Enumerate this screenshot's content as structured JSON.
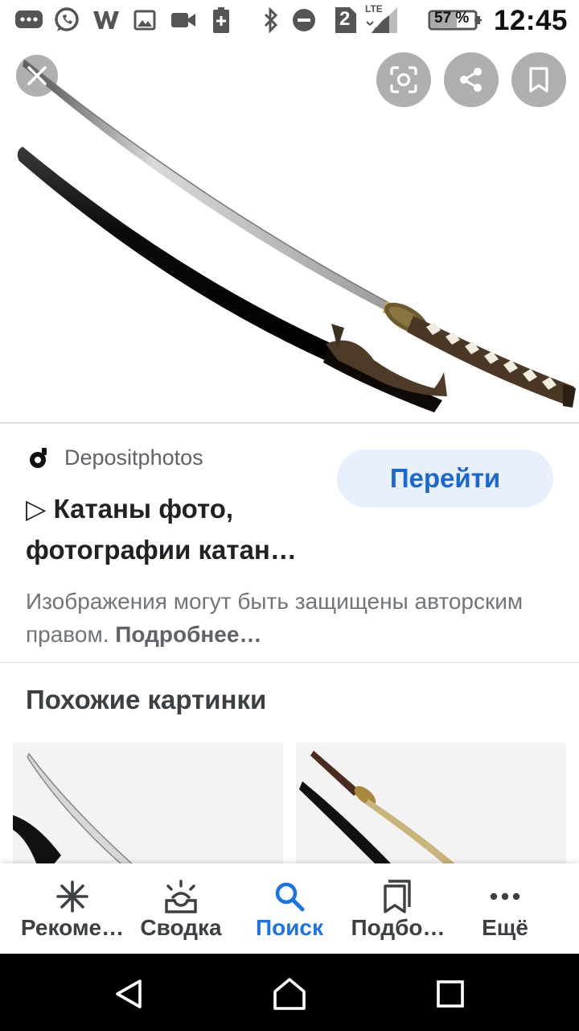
{
  "status_bar": {
    "time": "12:45",
    "battery_percent": "57 %",
    "sim_slot": "2",
    "network": "LTE",
    "icons": [
      "chat-icon",
      "whatsapp-icon",
      "w-app-icon",
      "image-icon",
      "video-icon",
      "battery-saver-icon",
      "bluetooth-icon",
      "dnd-icon",
      "sim-icon",
      "signal-icon",
      "battery-icon"
    ]
  },
  "viewer": {
    "buttons": [
      "close-icon",
      "lens-icon",
      "share-icon",
      "bookmark-icon"
    ]
  },
  "result": {
    "source": "Depositphotos",
    "title_line1": "▷ Катаны фото,",
    "title_line2": "фотографии катан…",
    "goto_label": "Перейти",
    "copyright_text": "Изображения могут быть защищены авторским правом.",
    "more_label": "Подробнее…"
  },
  "similar": {
    "title": "Похожие картинки"
  },
  "bottom_nav": {
    "items": [
      {
        "label": "Рекоме…",
        "icon": "asterisk-icon"
      },
      {
        "label": "Сводка",
        "icon": "sunrise-inbox-icon"
      },
      {
        "label": "Поиск",
        "icon": "search-icon"
      },
      {
        "label": "Подбо…",
        "icon": "collections-icon"
      },
      {
        "label": "Ещё",
        "icon": "more-dots-icon"
      }
    ],
    "active": "Поиск",
    "accent_color": "#1a73e8"
  },
  "system_nav": {
    "buttons": [
      "back-icon",
      "home-icon",
      "recents-icon"
    ]
  }
}
